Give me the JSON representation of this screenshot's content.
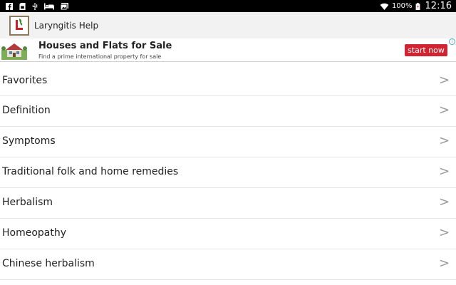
{
  "status_bar": {
    "left_icons": [
      "facebook-icon",
      "sd-card-icon",
      "usb-icon",
      "sleep-icon",
      "photo-icon"
    ],
    "battery_text": "100%",
    "time": "12:16"
  },
  "app_bar": {
    "title": "Laryngitis Help",
    "icon": "app-logo-icon"
  },
  "ad": {
    "headline": "Houses and Flats for Sale",
    "subtitle": "Find a prime international property for sale",
    "cta_label": "start now",
    "cta_color": "#d02433",
    "info_glyph": "i"
  },
  "list": {
    "chevron": ">",
    "items": [
      {
        "label": "Favorites"
      },
      {
        "label": "Definition"
      },
      {
        "label": "Symptoms"
      },
      {
        "label": "Traditional folk and home remedies"
      },
      {
        "label": "Herbalism"
      },
      {
        "label": "Homeopathy"
      },
      {
        "label": "Chinese herbalism"
      }
    ]
  }
}
